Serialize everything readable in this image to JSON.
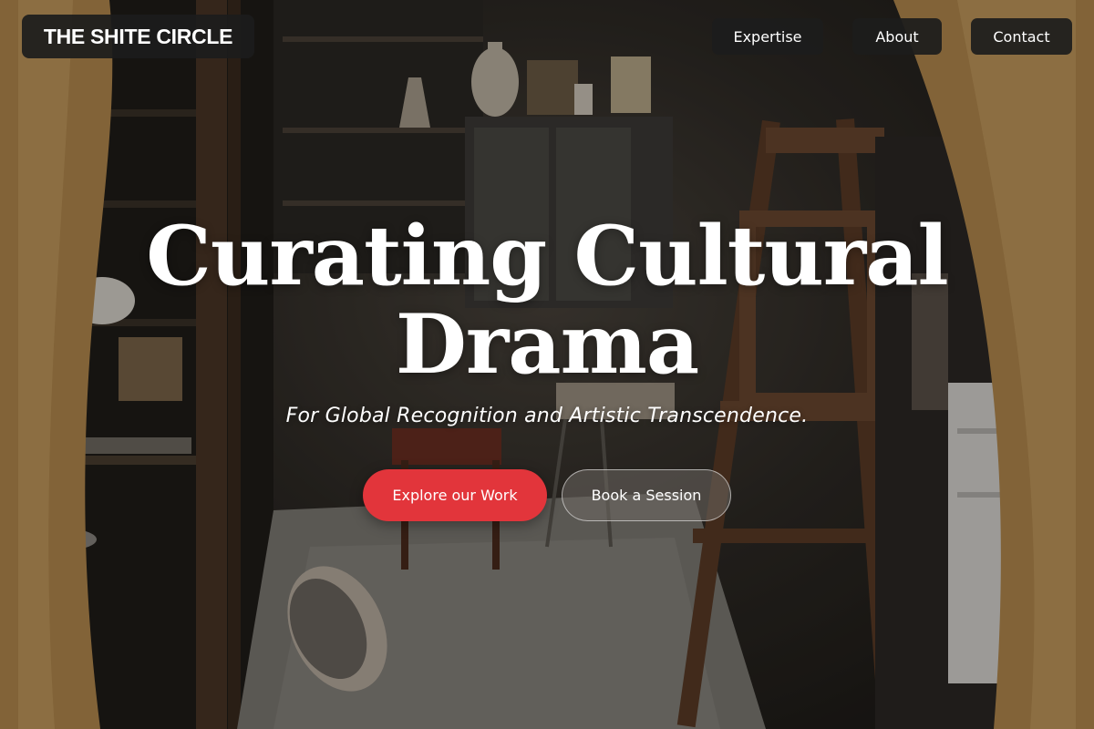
{
  "header": {
    "logo_text": "THE SHITE CIRCLE",
    "nav": [
      {
        "label": "Expertise"
      },
      {
        "label": "About"
      },
      {
        "label": "Contact"
      }
    ]
  },
  "hero": {
    "title_line_1": "Curating Cultural",
    "title_line_2": "Drama",
    "subtitle": "For Global Recognition and Artistic Transcendence.",
    "primary_cta": "Explore our Work",
    "secondary_cta": "Book a Session",
    "background_description_icon": "artist-studio-background",
    "colors": {
      "accent": "#e2353b",
      "nav_bg": "#1c1c1c",
      "text": "#ffffff"
    }
  }
}
